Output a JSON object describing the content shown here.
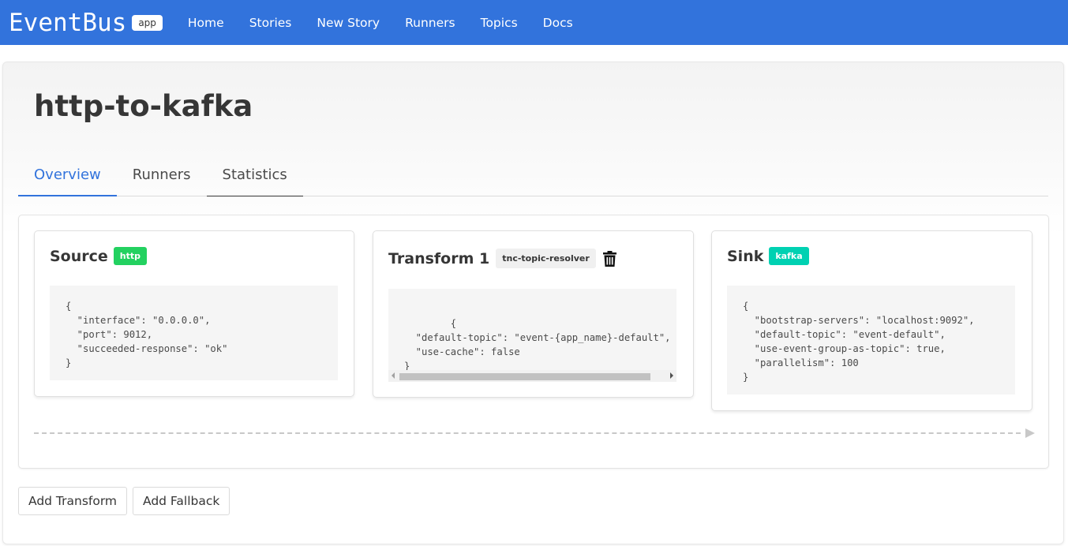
{
  "navbar": {
    "brand": "EventBus",
    "brand_tag": "app",
    "items": [
      "Home",
      "Stories",
      "New Story",
      "Runners",
      "Topics",
      "Docs"
    ]
  },
  "page": {
    "title": "http-to-kafka"
  },
  "tabs": [
    "Overview",
    "Runners",
    "Statistics"
  ],
  "active_tab": "Overview",
  "source": {
    "title": "Source",
    "tag": "http",
    "config": "{\n  \"interface\": \"0.0.0.0\",\n  \"port\": 9012,\n  \"succeeded-response\": \"ok\"\n}"
  },
  "transform": {
    "title": "Transform 1",
    "tag": "tnc-topic-resolver",
    "delete_icon": "trash-icon",
    "config": "{\n  \"default-topic\": \"event-{app_name}-default\",\n  \"use-cache\": false\n}"
  },
  "sink": {
    "title": "Sink",
    "tag": "kafka",
    "config": "{\n  \"bootstrap-servers\": \"localhost:9092\",\n  \"default-topic\": \"event-default\",\n  \"use-event-group-as-topic\": true,\n  \"parallelism\": 100\n}"
  },
  "actions": {
    "add_transform": "Add Transform",
    "add_fallback": "Add Fallback"
  },
  "colors": {
    "navbar": "#3273dc",
    "link": "#3273dc",
    "tag_http": "#23d160",
    "tag_kafka": "#00d1b2"
  }
}
